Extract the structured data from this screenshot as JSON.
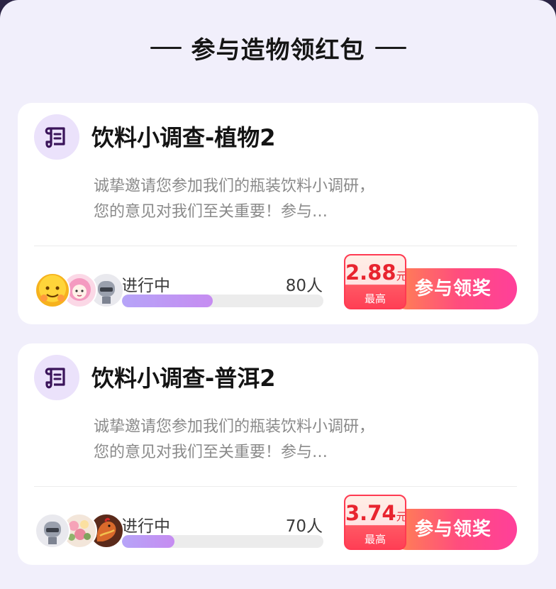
{
  "section": {
    "title": "参与造物领红包"
  },
  "colors": {
    "accent_purple": "#b6a4f8",
    "cta_orange": "#ff8a4c",
    "cta_pink": "#ff3f9a",
    "badge_red": "#e8242f"
  },
  "cards": [
    {
      "icon": "scroll-icon",
      "title": "饮料小调查-植物2",
      "description": "诚挚邀请您参加我们的瓶装饮料小调研，您的意见对我们至关重要！参与…",
      "status": "进行中",
      "participants": "80人",
      "progress": 0.45,
      "reward": {
        "amount": "2.88",
        "unit": "元",
        "label": "最高"
      },
      "cta": "参与领奖",
      "avatars": [
        "smiley-avatar",
        "girl-avatar",
        "knight-avatar"
      ]
    },
    {
      "icon": "scroll-icon",
      "title": "饮料小调查-普洱2",
      "description": "诚挚邀请您参加我们的瓶装饮料小调研，您的意见对我们至关重要！参与…",
      "status": "进行中",
      "participants": "70人",
      "progress": 0.26,
      "reward": {
        "amount": "3.74",
        "unit": "元",
        "label": "最高"
      },
      "cta": "参与领奖",
      "avatars": [
        "knight-avatar",
        "flowers-avatar",
        "rooster-avatar"
      ]
    }
  ]
}
